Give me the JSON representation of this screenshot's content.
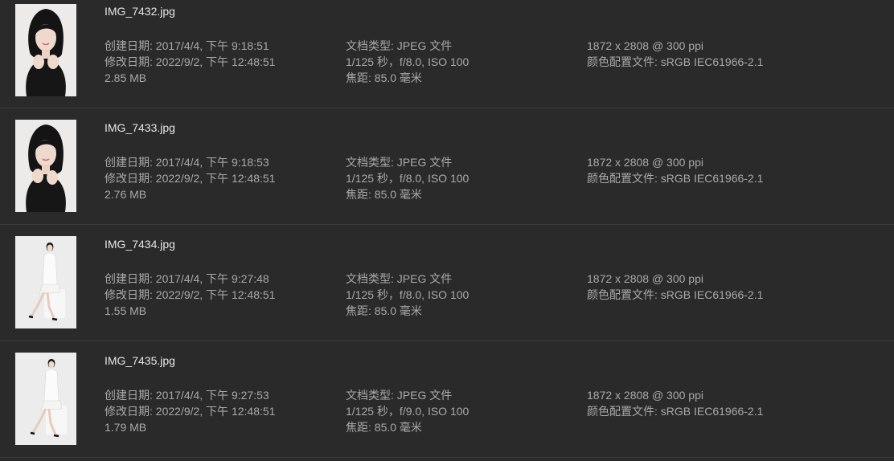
{
  "files": [
    {
      "name": "IMG_7432.jpg",
      "thumbnail": "portrait-closeup",
      "created": "创建日期: 2017/4/4, 下午 9:18:51",
      "modified": "修改日期: 2022/9/2, 下午 12:48:51",
      "size": "2.85 MB",
      "type": "文档类型: JPEG 文件",
      "exposure": "1/125 秒，f/8.0, ISO 100",
      "focal": "焦距: 85.0 毫米",
      "dimensions": "1872 x 2808 @ 300 ppi",
      "profile": "颜色配置文件: sRGB IEC61966-2.1"
    },
    {
      "name": "IMG_7433.jpg",
      "thumbnail": "portrait-closeup",
      "created": "创建日期: 2017/4/4, 下午 9:18:53",
      "modified": "修改日期: 2022/9/2, 下午 12:48:51",
      "size": "2.76 MB",
      "type": "文档类型: JPEG 文件",
      "exposure": "1/125 秒，f/8.0, ISO 100",
      "focal": "焦距: 85.0 毫米",
      "dimensions": "1872 x 2808 @ 300 ppi",
      "profile": "颜色配置文件: sRGB IEC61966-2.1"
    },
    {
      "name": "IMG_7434.jpg",
      "thumbnail": "full-body-seated",
      "created": "创建日期: 2017/4/4, 下午 9:27:48",
      "modified": "修改日期: 2022/9/2, 下午 12:48:51",
      "size": "1.55 MB",
      "type": "文档类型: JPEG 文件",
      "exposure": "1/125 秒，f/8.0, ISO 100",
      "focal": "焦距: 85.0 毫米",
      "dimensions": "1872 x 2808 @ 300 ppi",
      "profile": "颜色配置文件: sRGB IEC61966-2.1"
    },
    {
      "name": "IMG_7435.jpg",
      "thumbnail": "full-body-seated",
      "created": "创建日期: 2017/4/4, 下午 9:27:53",
      "modified": "修改日期: 2022/9/2, 下午 12:48:51",
      "size": "1.79 MB",
      "type": "文档类型: JPEG 文件",
      "exposure": "1/125 秒，f/9.0, ISO 100",
      "focal": "焦距: 85.0 毫米",
      "dimensions": "1872 x 2808 @ 300 ppi",
      "profile": "颜色配置文件: sRGB IEC61966-2.1"
    }
  ]
}
